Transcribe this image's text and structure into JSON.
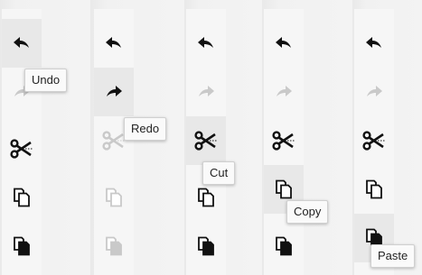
{
  "colors": {
    "enabled": "#111111",
    "disabled": "#c9c9c9",
    "hover_bg": "#e8e8e8"
  },
  "frames": [
    {
      "state": "undo-hover",
      "tooltip": "Undo",
      "buttons": [
        {
          "action": "undo",
          "icon": "undo-icon",
          "enabled": true
        },
        {
          "action": "redo",
          "icon": "redo-icon",
          "enabled": false
        },
        {
          "action": "cut",
          "icon": "scissors-icon",
          "enabled": true
        },
        {
          "action": "copy",
          "icon": "copy-icon",
          "enabled": true
        },
        {
          "action": "paste",
          "icon": "paste-icon",
          "enabled": true
        }
      ]
    },
    {
      "state": "redo-hover",
      "tooltip": "Redo",
      "buttons": [
        {
          "action": "undo",
          "icon": "undo-icon",
          "enabled": true
        },
        {
          "action": "redo",
          "icon": "redo-icon",
          "enabled": true
        },
        {
          "action": "cut",
          "icon": "scissors-icon",
          "enabled": false
        },
        {
          "action": "copy",
          "icon": "copy-icon",
          "enabled": false
        },
        {
          "action": "paste",
          "icon": "paste-icon",
          "enabled": false
        }
      ]
    },
    {
      "state": "cut-hover",
      "tooltip": "Cut",
      "buttons": [
        {
          "action": "undo",
          "icon": "undo-icon",
          "enabled": true
        },
        {
          "action": "redo",
          "icon": "redo-icon",
          "enabled": false
        },
        {
          "action": "cut",
          "icon": "scissors-icon",
          "enabled": true
        },
        {
          "action": "copy",
          "icon": "copy-icon",
          "enabled": true
        },
        {
          "action": "paste",
          "icon": "paste-icon",
          "enabled": true
        }
      ]
    },
    {
      "state": "copy-hover",
      "tooltip": "Copy",
      "buttons": [
        {
          "action": "undo",
          "icon": "undo-icon",
          "enabled": true
        },
        {
          "action": "redo",
          "icon": "redo-icon",
          "enabled": false
        },
        {
          "action": "cut",
          "icon": "scissors-icon",
          "enabled": true
        },
        {
          "action": "copy",
          "icon": "copy-icon",
          "enabled": true
        },
        {
          "action": "paste",
          "icon": "paste-icon",
          "enabled": true
        }
      ]
    },
    {
      "state": "paste-hover",
      "tooltip": "Paste",
      "buttons": [
        {
          "action": "undo",
          "icon": "undo-icon",
          "enabled": true
        },
        {
          "action": "redo",
          "icon": "redo-icon",
          "enabled": false
        },
        {
          "action": "cut",
          "icon": "scissors-icon",
          "enabled": true
        },
        {
          "action": "copy",
          "icon": "copy-icon",
          "enabled": true
        },
        {
          "action": "paste",
          "icon": "paste-icon",
          "enabled": true
        }
      ]
    }
  ]
}
